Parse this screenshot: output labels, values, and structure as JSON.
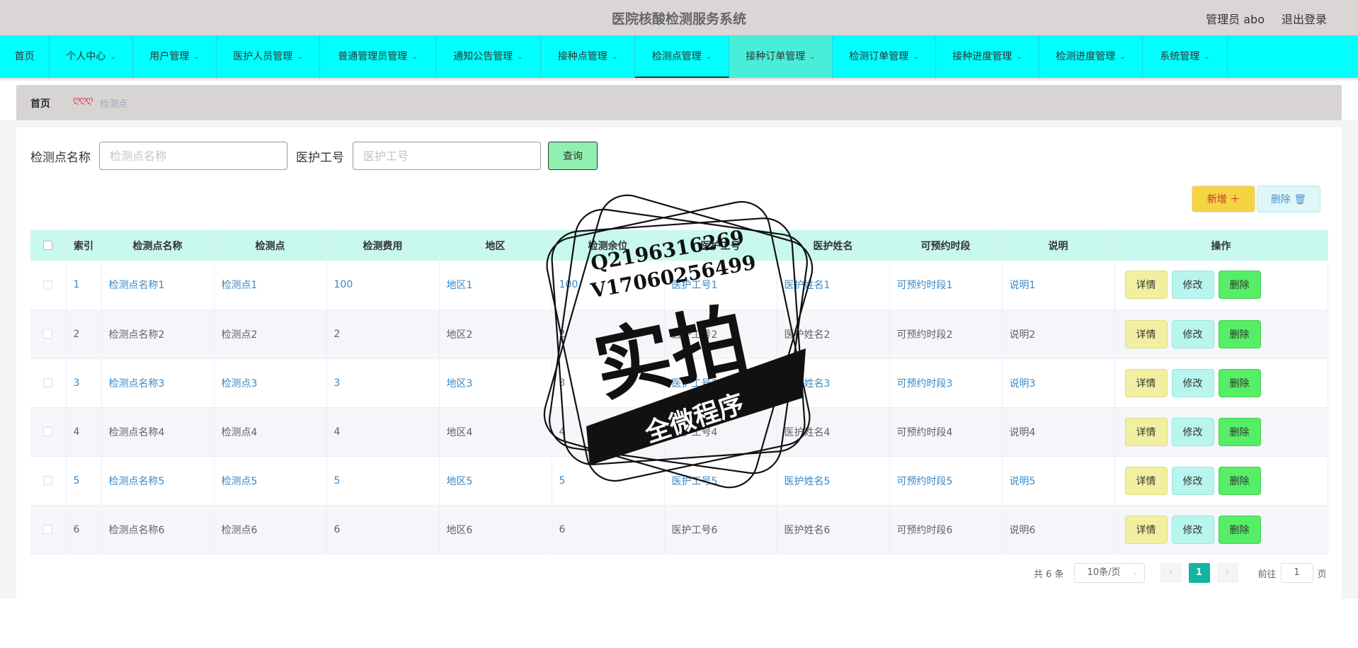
{
  "header": {
    "title": "医院核酸检测服务系统",
    "user_label": "管理员 abo",
    "logout_label": "退出登录"
  },
  "nav": {
    "items": [
      {
        "label": "首页",
        "has_dropdown": false
      },
      {
        "label": "个人中心",
        "has_dropdown": true
      },
      {
        "label": "用户管理",
        "has_dropdown": true
      },
      {
        "label": "医护人员管理",
        "has_dropdown": true
      },
      {
        "label": "普通管理员管理",
        "has_dropdown": true
      },
      {
        "label": "通知公告管理",
        "has_dropdown": true
      },
      {
        "label": "接种点管理",
        "has_dropdown": true
      },
      {
        "label": "检测点管理",
        "has_dropdown": true,
        "active": true
      },
      {
        "label": "接种订单管理",
        "has_dropdown": true,
        "hover": true
      },
      {
        "label": "检测订单管理",
        "has_dropdown": true
      },
      {
        "label": "接种进度管理",
        "has_dropdown": true
      },
      {
        "label": "检测进度管理",
        "has_dropdown": true
      },
      {
        "label": "系统管理",
        "has_dropdown": true
      }
    ]
  },
  "breadcrumb": {
    "home": "首页",
    "separator": "ღღღ",
    "current": "检测点"
  },
  "search": {
    "name_label": "检测点名称",
    "name_placeholder": "检测点名称",
    "staff_label": "医护工号",
    "staff_placeholder": "医护工号",
    "query_label": "查询"
  },
  "actions": {
    "add_label": "新增 ＋",
    "delete_label": "删除 🗑"
  },
  "table": {
    "columns": [
      "索引",
      "检测点名称",
      "检测点",
      "检测费用",
      "地区",
      "检测余位",
      "医护工号",
      "医护姓名",
      "可预约时段",
      "说明",
      "操作"
    ],
    "rows": [
      {
        "index": "1",
        "name": "检测点名称1",
        "point": "检测点1",
        "fee": "100",
        "region": "地区1",
        "remaining": "100",
        "staff_no": "医护工号1",
        "staff_name": "医护姓名1",
        "slot": "可预约时段1",
        "note": "说明1"
      },
      {
        "index": "2",
        "name": "检测点名称2",
        "point": "检测点2",
        "fee": "2",
        "region": "地区2",
        "remaining": "2",
        "staff_no": "医护工号2",
        "staff_name": "医护姓名2",
        "slot": "可预约时段2",
        "note": "说明2"
      },
      {
        "index": "3",
        "name": "检测点名称3",
        "point": "检测点3",
        "fee": "3",
        "region": "地区3",
        "remaining": "3",
        "staff_no": "医护工号3",
        "staff_name": "医护姓名3",
        "slot": "可预约时段3",
        "note": "说明3"
      },
      {
        "index": "4",
        "name": "检测点名称4",
        "point": "检测点4",
        "fee": "4",
        "region": "地区4",
        "remaining": "4",
        "staff_no": "医护工号4",
        "staff_name": "医护姓名4",
        "slot": "可预约时段4",
        "note": "说明4"
      },
      {
        "index": "5",
        "name": "检测点名称5",
        "point": "检测点5",
        "fee": "5",
        "region": "地区5",
        "remaining": "5",
        "staff_no": "医护工号5",
        "staff_name": "医护姓名5",
        "slot": "可预约时段5",
        "note": "说明5"
      },
      {
        "index": "6",
        "name": "检测点名称6",
        "point": "检测点6",
        "fee": "6",
        "region": "地区6",
        "remaining": "6",
        "staff_no": "医护工号6",
        "staff_name": "医护姓名6",
        "slot": "可预约时段6",
        "note": "说明6"
      }
    ],
    "row_actions": {
      "detail": "详情",
      "edit": "修改",
      "delete": "删除"
    }
  },
  "pagination": {
    "total_text": "共 6 条",
    "page_size": "10条/页",
    "current_page": "1",
    "goto_prefix": "前往",
    "goto_value": "1",
    "goto_suffix": "页"
  },
  "watermark": {
    "line1": "Q2196316269",
    "line2": "V17060256499",
    "main": "实拍",
    "banner": "全微程序"
  },
  "colors": {
    "nav_bg": "#00ffff",
    "header_bg": "#dbd6d6",
    "table_head_bg": "#c8f8ee",
    "link": "#3a88c5",
    "pager_active": "#13b5a0"
  }
}
